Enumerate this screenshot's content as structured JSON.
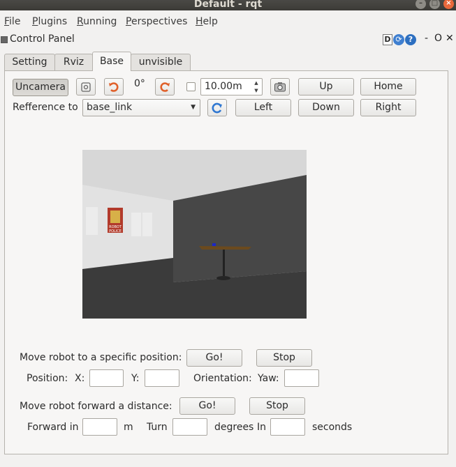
{
  "window": {
    "title": "Default - rqt"
  },
  "menubar": {
    "items": [
      {
        "first": "F",
        "rest": "ile"
      },
      {
        "first": "P",
        "rest": "lugins"
      },
      {
        "first": "R",
        "rest": "unning"
      },
      {
        "first": "P",
        "rest": "erspectives"
      },
      {
        "first": "H",
        "rest": "elp"
      }
    ]
  },
  "control_panel": {
    "title": "Control Panel",
    "d_label": "D",
    "refresh_glyph": "⟳",
    "help_glyph": "?",
    "minimize_glyph": "-",
    "float_glyph": "O",
    "close_glyph": "✕"
  },
  "tabs": [
    "Setting",
    "Rviz",
    "Base",
    "unvisible"
  ],
  "toolbar": {
    "uncamera_label": "Uncamera",
    "angle_value": "0°",
    "distance_value": "10.00m",
    "up_label": "Up",
    "home_label": "Home",
    "left_label": "Left",
    "down_label": "Down",
    "right_label": "Right",
    "reference_label": "Refference to",
    "reference_value": "base_link"
  },
  "move_position": {
    "label": "Move robot to a specific position:",
    "go_label": "Go!",
    "stop_label": "Stop",
    "position_label": "Position:",
    "x_label": "X:",
    "y_label": "Y:",
    "orientation_label": "Orientation:",
    "yaw_label": "Yaw:",
    "x_value": "",
    "y_value": "",
    "yaw_value": ""
  },
  "move_forward": {
    "label": "Move robot forward a distance:",
    "go_label": "Go!",
    "stop_label": "Stop",
    "forward_label": "Forward in",
    "m_label": "m",
    "turn_label": "Turn",
    "degrees_label": "degrees",
    "in_label": "In",
    "seconds_label": "seconds",
    "forward_value": "",
    "turn_value": "",
    "seconds_value": ""
  },
  "poster": {
    "line1": "ROBOT",
    "line2": "POLICE"
  }
}
